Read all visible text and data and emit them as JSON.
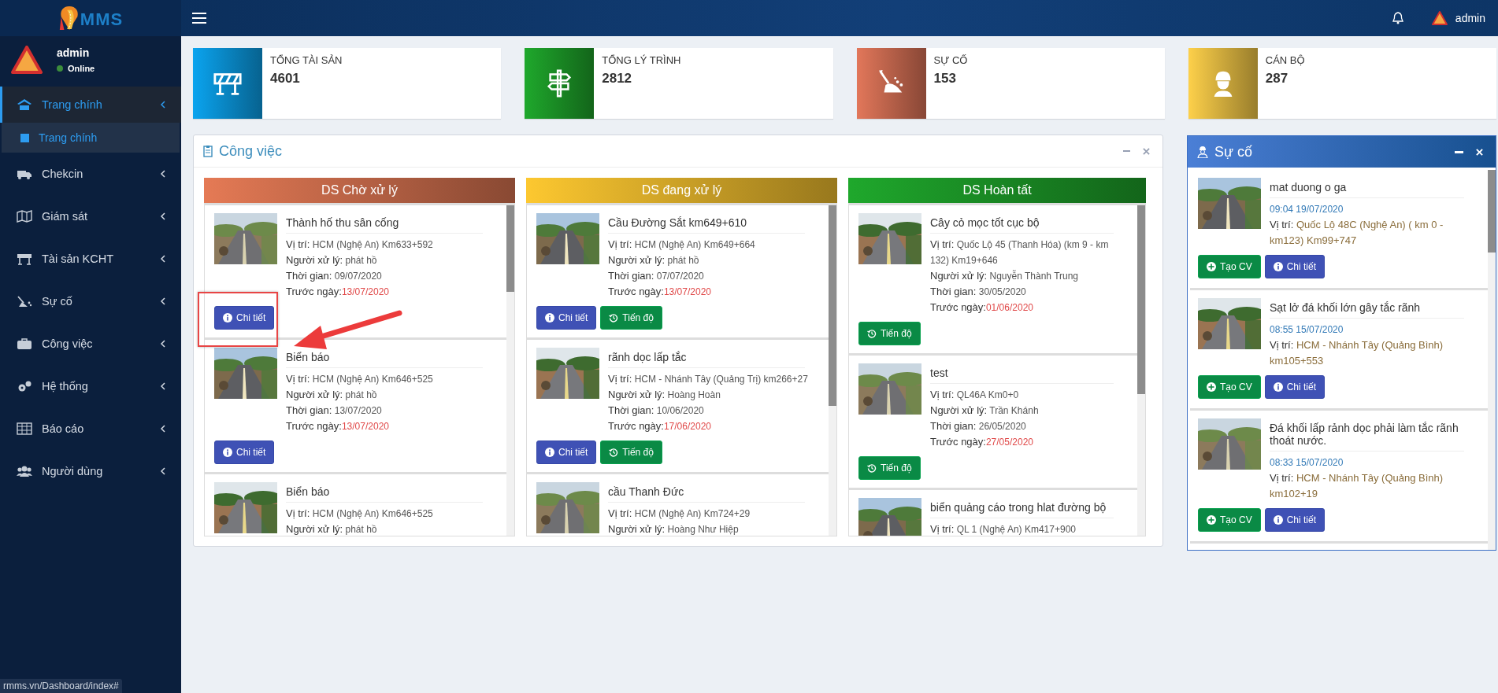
{
  "topbar": {
    "logo_text": "MMS",
    "user": "admin"
  },
  "sidebar": {
    "user": {
      "name": "admin",
      "status": "Online"
    },
    "items": [
      {
        "label": "Trang chính",
        "selected": true,
        "expanded": true,
        "children": [
          {
            "label": "Trang chính",
            "selected": true
          }
        ]
      },
      {
        "label": "Chekcin",
        "selected": false,
        "expanded": false
      },
      {
        "label": "Giám sát",
        "selected": false,
        "expanded": false
      },
      {
        "label": "Tài sản KCHT",
        "selected": false,
        "expanded": false
      },
      {
        "label": "Sự cố",
        "selected": false,
        "expanded": false
      },
      {
        "label": "Công việc",
        "selected": false,
        "expanded": false
      },
      {
        "label": "Hệ thống",
        "selected": false,
        "expanded": false
      },
      {
        "label": "Báo cáo",
        "selected": false,
        "expanded": false
      },
      {
        "label": "Người dùng",
        "selected": false,
        "expanded": false
      }
    ]
  },
  "stats": [
    {
      "label": "TỔNG TÀI SẢN",
      "value": "4601",
      "color": "#0ba4ef"
    },
    {
      "label": "TỔNG LÝ TRÌNH",
      "value": "2812",
      "color": "#1fa82c"
    },
    {
      "label": "SỰ CỐ",
      "value": "153",
      "color": "#e2775a"
    },
    {
      "label": "CÁN BỘ",
      "value": "287",
      "color": "#fdd04a"
    }
  ],
  "work_panel": {
    "title": "Công việc",
    "columns": [
      {
        "title": "DS Chờ xử lý",
        "color": "#e57a55",
        "items": [
          {
            "title": "Thành hố thu sân cống",
            "rows": [
              {
                "kind": "text",
                "label": "Vị trí:",
                "value": "HCM (Nghệ An) Km633+592"
              },
              {
                "kind": "text",
                "label": "Người xử lý:",
                "value": "phát hồ"
              },
              {
                "kind": "text",
                "label": "Thời gian:",
                "value": "09/07/2020"
              },
              {
                "kind": "deadline",
                "label": "Trước ngày:",
                "value": "13/07/2020"
              }
            ],
            "buttons": [
              {
                "kind": "detail",
                "label": "Chi tiết"
              }
            ]
          },
          {
            "title": "Biển báo",
            "rows": [
              {
                "kind": "text",
                "label": "Vị trí:",
                "value": "HCM (Nghệ An) Km646+525"
              },
              {
                "kind": "text",
                "label": "Người xử lý:",
                "value": "phát hồ"
              },
              {
                "kind": "text",
                "label": "Thời gian:",
                "value": "13/07/2020"
              },
              {
                "kind": "deadline",
                "label": "Trước ngày:",
                "value": "13/07/2020"
              }
            ],
            "buttons": [
              {
                "kind": "detail",
                "label": "Chi tiết"
              }
            ]
          },
          {
            "title": "Biển báo",
            "rows": [
              {
                "kind": "text",
                "label": "Vị trí:",
                "value": "HCM (Nghệ An) Km646+525"
              },
              {
                "kind": "text",
                "label": "Người xử lý:",
                "value": "phát hồ"
              }
            ]
          }
        ]
      },
      {
        "title": "DS đang xử lý",
        "color": "#fdc830",
        "items": [
          {
            "title": "Cầu Đường Sắt km649+610",
            "rows": [
              {
                "kind": "text",
                "label": "Vị trí:",
                "value": "HCM (Nghệ An) Km649+664"
              },
              {
                "kind": "text",
                "label": "Người xử lý:",
                "value": "phát hồ"
              },
              {
                "kind": "text",
                "label": "Thời gian:",
                "value": "07/07/2020"
              },
              {
                "kind": "deadline",
                "label": "Trước ngày:",
                "value": "13/07/2020"
              }
            ],
            "buttons": [
              {
                "kind": "detail",
                "label": "Chi tiết"
              },
              {
                "kind": "progress",
                "label": "Tiến độ"
              }
            ]
          },
          {
            "title": "rãnh dọc lấp tắc",
            "rows": [
              {
                "kind": "text",
                "label": "Vị trí:",
                "value": "HCM - Nhánh Tây (Quảng Trị) km266+27"
              },
              {
                "kind": "text",
                "label": "Người xử lý:",
                "value": "Hoàng Hoàn"
              },
              {
                "kind": "text",
                "label": "Thời gian:",
                "value": "10/06/2020"
              },
              {
                "kind": "deadline",
                "label": "Trước ngày:",
                "value": "17/06/2020"
              }
            ],
            "buttons": [
              {
                "kind": "detail",
                "label": "Chi tiết"
              },
              {
                "kind": "progress",
                "label": "Tiến độ"
              }
            ]
          },
          {
            "title": "cầu Thanh Đức",
            "rows": [
              {
                "kind": "text",
                "label": "Vị trí:",
                "value": "HCM (Nghệ An) Km724+29"
              },
              {
                "kind": "text",
                "label": "Người xử lý:",
                "value": "Hoàng Như Hiệp"
              }
            ]
          }
        ]
      },
      {
        "title": "DS Hoàn tất",
        "color": "#1fa82c",
        "items": [
          {
            "title": "Cây cỏ mọc tốt cục bộ",
            "rows": [
              {
                "kind": "text",
                "label": "Vị trí:",
                "value": "Quốc Lộ 45 (Thanh Hóa) (km 9 - km 132) Km19+646"
              },
              {
                "kind": "text",
                "label": "Người xử lý:",
                "value": "Nguyễn Thành Trung"
              },
              {
                "kind": "text",
                "label": "Thời gian:",
                "value": "30/05/2020"
              },
              {
                "kind": "deadline",
                "label": "Trước ngày:",
                "value": "01/06/2020"
              }
            ],
            "buttons": [
              {
                "kind": "progress",
                "label": "Tiến độ"
              }
            ]
          },
          {
            "title": "test",
            "rows": [
              {
                "kind": "text",
                "label": "Vị trí:",
                "value": "QL46A Km0+0"
              },
              {
                "kind": "text",
                "label": "Người xử lý:",
                "value": "Trần Khánh"
              },
              {
                "kind": "text",
                "label": "Thời gian:",
                "value": "26/05/2020"
              },
              {
                "kind": "deadline",
                "label": "Trước ngày:",
                "value": "27/05/2020"
              }
            ],
            "buttons": [
              {
                "kind": "progress",
                "label": "Tiến độ"
              }
            ]
          },
          {
            "title": "biển quảng cáo trong hlat đường bộ",
            "rows": [
              {
                "kind": "text",
                "label": "Vị trí:",
                "value": "QL 1 (Nghệ An) Km417+900"
              }
            ]
          }
        ]
      }
    ]
  },
  "incident_panel": {
    "title": "Sự cố",
    "items": [
      {
        "title": "mat duong o ga",
        "time": "09:04 19/07/2020",
        "location_label": "Vị trí:",
        "location": "Quốc Lộ 48C (Nghệ An) ( km 0 - km123) Km99+747",
        "buttons": [
          {
            "kind": "create",
            "label": "Tạo CV"
          },
          {
            "kind": "detail",
            "label": "Chi tiết"
          }
        ]
      },
      {
        "title": "Sạt lở đá khối lớn gây tắc rãnh",
        "time": "08:55 15/07/2020",
        "location_label": "Vị trí:",
        "location": "HCM - Nhánh Tây (Quảng Bình) km105+553",
        "buttons": [
          {
            "kind": "create",
            "label": "Tạo CV"
          },
          {
            "kind": "detail",
            "label": "Chi tiết"
          }
        ]
      },
      {
        "title": "Đá khối lấp rảnh dọc phải làm tắc rãnh thoát nước.",
        "time": "08:33 15/07/2020",
        "location_label": "Vị trí:",
        "location": "HCM - Nhánh Tây (Quảng Bình) km102+19",
        "buttons": [
          {
            "kind": "create",
            "label": "Tạo CV"
          },
          {
            "kind": "detail",
            "label": "Chi tiết"
          }
        ]
      }
    ]
  },
  "annotations": [
    {
      "kind": "highlight-box"
    },
    {
      "kind": "arrow"
    }
  ],
  "status_url": "rmms.vn/Dashboard/index#"
}
